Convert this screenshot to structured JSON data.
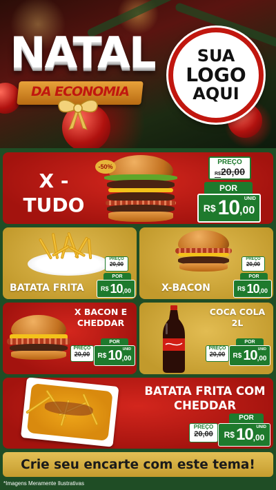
{
  "header": {
    "title": "NATAL",
    "subtitle": "DA ECONOMIA",
    "logo_line1": "SUA",
    "logo_line2": "LOGO",
    "logo_line3": "AQUI"
  },
  "labels": {
    "preco": "PREÇO",
    "por": "POR",
    "currency": "R$",
    "unit": "UNID"
  },
  "products": [
    {
      "name_line1": "X -",
      "name_line2": "TUDO",
      "discount": "-50%",
      "old_price": "20,00",
      "new_int": "10",
      "new_cents": ",00"
    },
    {
      "name": "BATATA FRITA",
      "old_price": "20,00",
      "new_int": "10",
      "new_cents": ",00"
    },
    {
      "name": "X-BACON",
      "old_price": "20,00",
      "new_int": "10",
      "new_cents": ",00"
    },
    {
      "name_line1": "X BACON E",
      "name_line2": "CHEDDAR",
      "old_price": "20,00",
      "new_int": "10",
      "new_cents": ",00"
    },
    {
      "name_line1": "COCA COLA",
      "name_line2": "2L",
      "old_price": "20,00",
      "new_int": "10",
      "new_cents": ",00"
    },
    {
      "name_line1": "BATATA FRITA COM",
      "name_line2": "CHEDDAR",
      "old_price": "20,00",
      "new_int": "10",
      "new_cents": ",00"
    }
  ],
  "cta": "Crie seu encarte com este tema!",
  "footnote": "*Imagens Meramente Ilustrativas",
  "colors": {
    "red": "#c1170f",
    "gold": "#d9b044",
    "green": "#1e7a2d",
    "background": "#1f4d25"
  }
}
